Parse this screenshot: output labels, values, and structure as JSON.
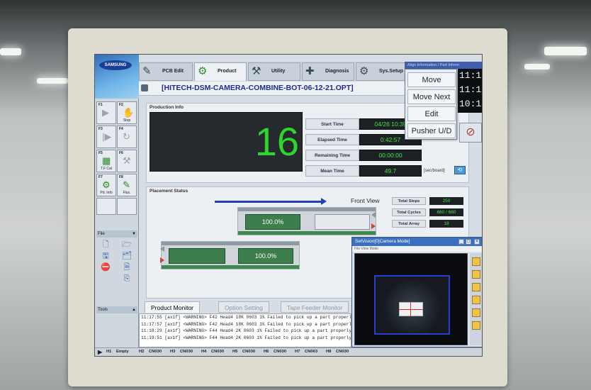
{
  "nav": {
    "logo": "SAMSUNG",
    "tabs": [
      {
        "label": "PCB Edit",
        "icon": "pcb-edit-icon"
      },
      {
        "label": "Product",
        "icon": "product-icon"
      },
      {
        "label": "Utility",
        "icon": "utility-icon"
      },
      {
        "label": "Diagnosis",
        "icon": "diagnosis-icon"
      },
      {
        "label": "Sys.Setup",
        "icon": "sys-setup-icon"
      }
    ]
  },
  "file_title": "[HITECH-DSM-CAMERA-COMBINE-BOT-06-12-21.OPT]",
  "function_keys": [
    {
      "key": "F1",
      "label": "",
      "icon": "play-icon"
    },
    {
      "key": "F2",
      "label": "Stop",
      "icon": "stop-hand-icon"
    },
    {
      "key": "F3",
      "label": "",
      "icon": "step-icon"
    },
    {
      "key": "F4",
      "label": "",
      "icon": "cycle-icon"
    },
    {
      "key": "F5",
      "label": "T.F Cal",
      "icon": "feeder-cal-icon"
    },
    {
      "key": "F6",
      "label": "",
      "icon": "tool-icon"
    },
    {
      "key": "F7",
      "label": "Pd. Info",
      "icon": "product-info-icon"
    },
    {
      "key": "F8",
      "label": "Flux.",
      "icon": "flux-icon"
    }
  ],
  "sidebar": {
    "file_section": "File",
    "tools_section": "Tools"
  },
  "production_info": {
    "heading": "Production Info",
    "count": "16",
    "start_time_label": "Start Time",
    "start_time": "04/26 10:39",
    "elapsed_time_label": "Elapsed Time",
    "elapsed_time": "0:42:57",
    "remaining_time_label": "Remaining Time",
    "remaining_time": "00:00:00",
    "mean_time_label": "Mean Time",
    "mean_time": "49.7",
    "mean_time_unit": "[sec/board]"
  },
  "placement_status": {
    "heading": "Placement Status",
    "view_label": "Front View",
    "upper_board_pct": "100.0%",
    "lower_board_pct": "100.0%",
    "total_steps_label": "Total Steps",
    "total_steps": "250",
    "total_cycles_label": "Total Cycles",
    "total_cycles": "660 / 660",
    "total_array_label": "Total Array",
    "total_array": "18"
  },
  "bottom_tabs": [
    "Product Monitor",
    "Option Setting",
    "Tape Feeder Monitor"
  ],
  "log_lines": [
    "11:17:55 [ax1f] <WARNING> F42 Head4 18K 0603 1% Failed to pick up a part properly.",
    "11:17:57 [ax1f] <WARNING> F42 Head4 18K 0603 1% Failed to pick up a part properly.",
    "11:18:29 [ax1f] <WARNING> F44 Head4 2K 0603 1% Failed to pick up a part properly.",
    "11:19:51 [ax1f] <WARNING> F44 Head4 2K 0603 1% Failed to pick up a part properly."
  ],
  "popup_menu": {
    "strip": "Align Information / Part Inform",
    "buttons": [
      "Move",
      "Move Next",
      "Edit",
      "Pusher U/D"
    ]
  },
  "clock_digits": [
    "11:1",
    "11:1",
    "10:1"
  ],
  "camera_window": {
    "title": "SetVision[0]Camera Mode]",
    "menu": "File  View  Mode",
    "controls": [
      "_",
      "□",
      "×"
    ]
  },
  "status_bar": [
    "H1",
    "Empty",
    "H2",
    "CN030",
    "H3",
    "CN030",
    "H4",
    "CN030",
    "H5",
    "CN030",
    "H6",
    "CN030",
    "H7",
    "CN063",
    "H8",
    "CN030"
  ],
  "colors": {
    "counter_green": "#2fd52f",
    "value_green": "#46e046",
    "title_blue": "#1c2d8c",
    "board_green": "#3c7f4c"
  }
}
